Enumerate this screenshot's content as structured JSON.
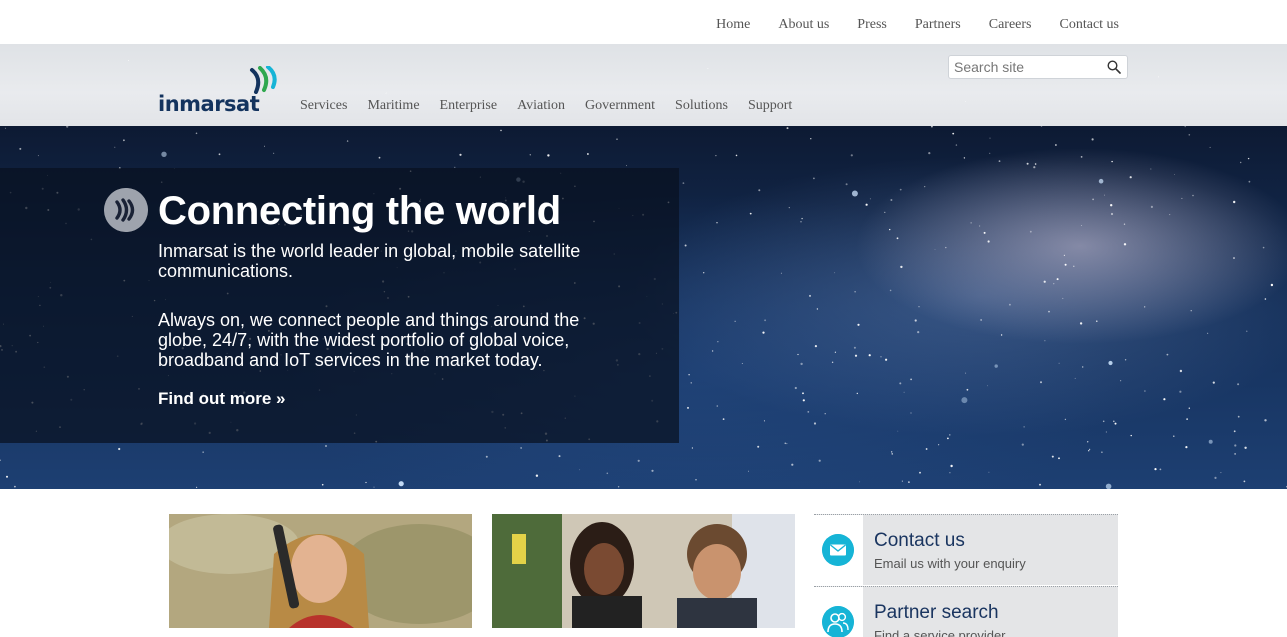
{
  "top_nav": {
    "items": [
      {
        "label": "Home"
      },
      {
        "label": "About us"
      },
      {
        "label": "Press"
      },
      {
        "label": "Partners"
      },
      {
        "label": "Careers"
      },
      {
        "label": "Contact us"
      }
    ]
  },
  "header": {
    "logo_text": "inmarsat",
    "search": {
      "placeholder": "Search site",
      "value": ""
    },
    "main_nav": [
      {
        "label": "Services"
      },
      {
        "label": "Maritime"
      },
      {
        "label": "Enterprise"
      },
      {
        "label": "Aviation"
      },
      {
        "label": "Government"
      },
      {
        "label": "Solutions"
      },
      {
        "label": "Support"
      }
    ]
  },
  "hero": {
    "title": "Connecting the world",
    "paragraph1": "Inmarsat is the world leader in global, mobile satellite communications.",
    "paragraph2": "Always on, we connect people and things around the globe, 24/7, with the widest portfolio of global voice, broadband and IoT services in the market today.",
    "cta": "Find out more »"
  },
  "sidebar": {
    "items": [
      {
        "title": "Contact us",
        "subtitle": "Email us with your enquiry",
        "icon": "envelope-icon"
      },
      {
        "title": "Partner search",
        "subtitle": "Find a service provider",
        "icon": "people-icon"
      }
    ]
  },
  "colors": {
    "brand_navy": "#13335e",
    "accent_cyan": "#16b4d6",
    "nav_text": "#555555"
  }
}
